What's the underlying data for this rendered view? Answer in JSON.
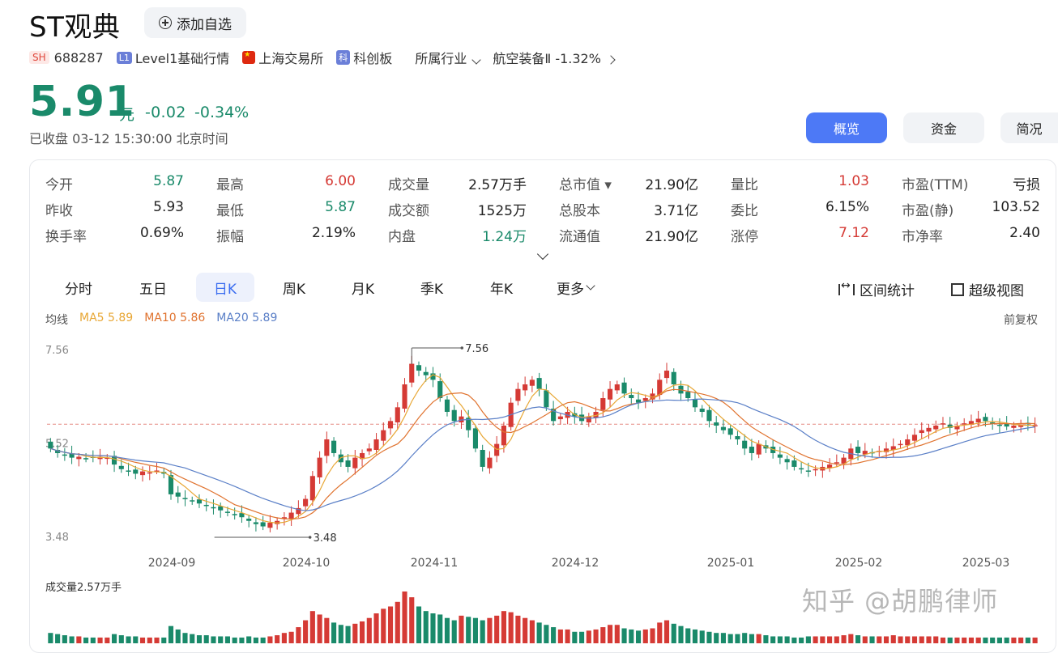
{
  "header": {
    "title": "ST观典",
    "watch_label": "添加自选"
  },
  "meta": {
    "exchange_badge": "SH",
    "code": "688287",
    "l1_badge": "L1",
    "level": "Level1基础行情",
    "exchange": "上海交易所",
    "board_badge": "科",
    "board": "科创板",
    "industry_label": "所属行业",
    "industry": "航空装备Ⅱ",
    "industry_change": "-1.32%"
  },
  "quote": {
    "price": "5.91",
    "unit": "元",
    "change": "-0.02",
    "change_pct": "-0.34%",
    "status": "已收盘 03-12 15:30:00 北京时间"
  },
  "view_tabs": [
    "概览",
    "资金",
    "简况"
  ],
  "stats": [
    [
      [
        "今开",
        "5.87",
        "green"
      ],
      [
        "最高",
        "6.00",
        "red"
      ],
      [
        "成交量",
        "2.57万手",
        "dark"
      ],
      [
        "总市值 ▾",
        "21.90亿",
        "dark"
      ],
      [
        "量比",
        "1.03",
        "red"
      ],
      [
        "市盈(TTM)",
        "亏损",
        "dark"
      ]
    ],
    [
      [
        "昨收",
        "5.93",
        "dark"
      ],
      [
        "最低",
        "5.87",
        "green"
      ],
      [
        "成交额",
        "1525万",
        "dark"
      ],
      [
        "总股本",
        "3.71亿",
        "dark"
      ],
      [
        "委比",
        "6.15%",
        "dark"
      ],
      [
        "市盈(静)",
        "103.52",
        "dark"
      ]
    ],
    [
      [
        "换手率",
        "0.69%",
        "dark"
      ],
      [
        "振幅",
        "2.19%",
        "dark"
      ],
      [
        "内盘",
        "1.24万",
        "green"
      ],
      [
        "流通值",
        "21.90亿",
        "dark"
      ],
      [
        "涨停",
        "7.12",
        "red"
      ],
      [
        "市净率",
        "2.40",
        "dark"
      ]
    ]
  ],
  "period_tabs": [
    "分时",
    "五日",
    "日K",
    "周K",
    "月K",
    "季K",
    "年K",
    "更多"
  ],
  "active_period": "日K",
  "tools": {
    "range_stats": "区间统计",
    "super_view": "超级视图"
  },
  "ma": {
    "label": "均线",
    "ma5": "MA5 5.89",
    "ma10": "MA10 5.86",
    "ma20": "MA20 5.89"
  },
  "adjust": "前复权",
  "colors": {
    "up": "#d53a35",
    "down": "#1a8a6a",
    "ma5": "#e8a735",
    "ma10": "#e0732f",
    "ma20": "#5a7fc7",
    "accent": "#4d79f6"
  },
  "chart_data": {
    "type": "candlestick",
    "y_ticks": [
      "7.56",
      "5.52",
      "3.48"
    ],
    "ylim": [
      3.48,
      7.56
    ],
    "x_ticks": [
      "2024-09",
      "2024-10",
      "2024-11",
      "2024-12",
      "2025-01",
      "2025-02",
      "2025-03"
    ],
    "high_annotation": "7.56",
    "low_annotation": "3.48",
    "reference_price": 5.93,
    "volume_label": "成交量2.57万手",
    "close": [
      5.4,
      5.3,
      5.25,
      5.2,
      5.22,
      5.18,
      5.2,
      5.22,
      5.2,
      5.05,
      4.95,
      4.9,
      4.85,
      4.9,
      4.88,
      4.92,
      4.85,
      4.4,
      4.35,
      4.3,
      4.25,
      4.2,
      4.15,
      4.1,
      4.05,
      4.0,
      3.95,
      3.9,
      3.82,
      3.75,
      3.7,
      3.78,
      3.82,
      3.9,
      4.0,
      4.1,
      4.3,
      4.8,
      5.2,
      5.6,
      5.3,
      5.1,
      5.0,
      5.2,
      5.3,
      5.4,
      5.6,
      5.8,
      6.0,
      6.3,
      6.8,
      7.25,
      7.1,
      7.0,
      6.9,
      6.5,
      6.2,
      6.0,
      6.1,
      5.8,
      5.4,
      5.0,
      5.2,
      5.5,
      5.9,
      6.4,
      6.7,
      6.8,
      6.9,
      6.7,
      6.3,
      6.0,
      6.1,
      6.2,
      6.1,
      6.0,
      6.1,
      6.2,
      6.5,
      6.7,
      6.8,
      6.6,
      6.5,
      6.4,
      6.5,
      6.6,
      6.9,
      7.1,
      6.8,
      6.6,
      6.5,
      6.3,
      6.2,
      6.0,
      5.9,
      5.8,
      5.7,
      5.6,
      5.4,
      5.3,
      5.5,
      5.4,
      5.3,
      5.2,
      5.1,
      5.0,
      4.95,
      4.9,
      4.95,
      5.0,
      5.05,
      5.1,
      5.2,
      5.4,
      5.3,
      5.35,
      5.3,
      5.35,
      5.4,
      5.45,
      5.5,
      5.6,
      5.7,
      5.8,
      5.85,
      5.9,
      5.95,
      5.85,
      5.9,
      5.95,
      6.0,
      6.05,
      6.0,
      5.95,
      5.9,
      5.88,
      5.9,
      5.92,
      5.93,
      5.91
    ],
    "volume": [
      0.9,
      0.8,
      0.7,
      0.6,
      0.6,
      0.5,
      0.5,
      0.5,
      0.5,
      0.8,
      0.7,
      0.6,
      0.6,
      0.5,
      0.5,
      0.5,
      0.5,
      1.5,
      1.2,
      0.9,
      0.8,
      0.7,
      0.7,
      0.6,
      0.6,
      0.6,
      0.5,
      0.5,
      0.6,
      0.5,
      0.5,
      0.6,
      0.7,
      0.9,
      1.0,
      1.4,
      2.0,
      2.8,
      2.5,
      2.2,
      1.8,
      1.6,
      1.5,
      1.7,
      1.9,
      2.2,
      2.6,
      3.0,
      3.2,
      3.6,
      4.5,
      4.0,
      3.2,
      2.8,
      2.6,
      2.5,
      2.2,
      2.0,
      2.4,
      2.3,
      2.2,
      2.0,
      2.2,
      2.4,
      2.8,
      2.7,
      2.4,
      2.2,
      2.0,
      1.8,
      1.6,
      1.4,
      1.2,
      1.2,
      1.0,
      1.0,
      1.1,
      1.2,
      1.4,
      1.6,
      1.6,
      1.3,
      1.2,
      1.1,
      1.2,
      1.3,
      1.8,
      2.0,
      1.7,
      1.5,
      1.3,
      1.2,
      1.1,
      1.0,
      0.9,
      0.9,
      0.8,
      0.8,
      0.9,
      0.8,
      0.8,
      0.7,
      0.6,
      0.6,
      0.6,
      0.5,
      0.5,
      0.6,
      0.6,
      0.6,
      0.6,
      0.6,
      0.7,
      0.8,
      0.7,
      0.6,
      0.6,
      0.6,
      0.6,
      0.7,
      0.6,
      0.6,
      0.6,
      0.6,
      0.6,
      0.6,
      0.5,
      0.5,
      0.5,
      0.5,
      0.5,
      0.5,
      0.5,
      0.5,
      0.5,
      0.5,
      0.5,
      0.5,
      0.5,
      0.5
    ]
  },
  "watermark": "知乎 @胡鹏律师"
}
